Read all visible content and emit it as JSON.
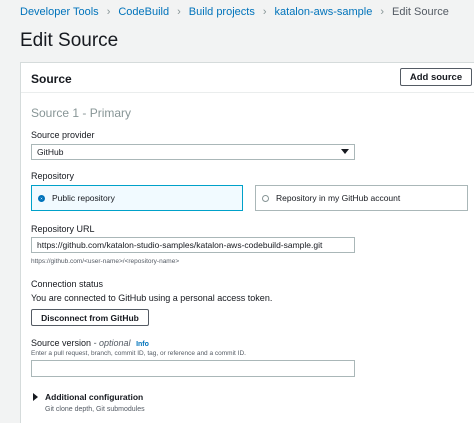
{
  "breadcrumb": {
    "items": [
      "Developer Tools",
      "CodeBuild",
      "Build projects",
      "katalon-aws-sample"
    ],
    "current": "Edit Source",
    "separator": "›"
  },
  "page": {
    "title": "Edit Source"
  },
  "panel": {
    "title": "Source",
    "add_source_label": "Add source",
    "section_title": "Source 1 - Primary",
    "provider": {
      "label": "Source provider",
      "value": "GitHub"
    },
    "repository": {
      "label": "Repository",
      "options": [
        {
          "label": "Public repository",
          "selected": true
        },
        {
          "label": "Repository in my GitHub account",
          "selected": false
        }
      ]
    },
    "repo_url": {
      "label": "Repository URL",
      "value": "https://github.com/katalon-studio-samples/katalon-aws-codebuild-sample.git",
      "hint": "https://github.com/<user-name>/<repository-name>"
    },
    "connection": {
      "label": "Connection status",
      "message": "You are connected to GitHub using a personal access token.",
      "disconnect_label": "Disconnect from GitHub"
    },
    "source_version": {
      "label": "Source version",
      "optional": " - optional",
      "info": "Info",
      "hint": "Enter a pull request, branch, commit ID, tag, or reference and a commit ID.",
      "value": ""
    },
    "additional": {
      "title": "Additional configuration",
      "subtitle": "Git clone depth, Git submodules"
    }
  },
  "colors": {
    "link": "#0073bb",
    "selected_border": "#00a1c9",
    "selected_bg": "#f1faff"
  }
}
